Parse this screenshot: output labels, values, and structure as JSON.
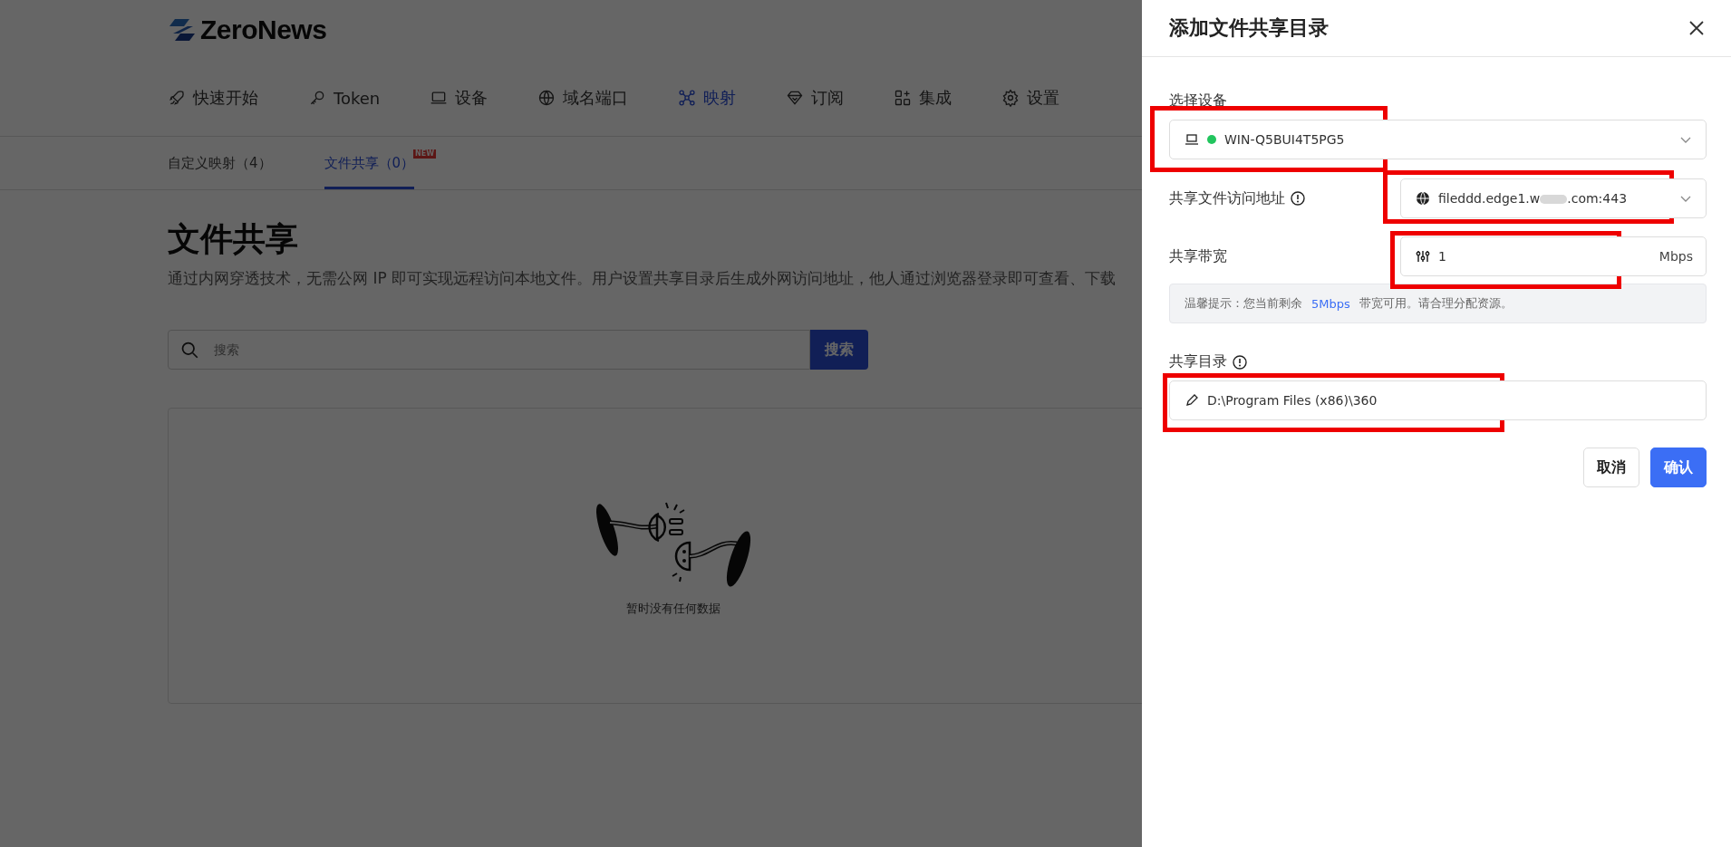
{
  "brand": {
    "name": "ZeroNews"
  },
  "nav": [
    {
      "label": "快速开始",
      "selected": false
    },
    {
      "label": "Token",
      "selected": false
    },
    {
      "label": "设备",
      "selected": false
    },
    {
      "label": "域名端口",
      "selected": false
    },
    {
      "label": "映射",
      "selected": true
    },
    {
      "label": "订阅",
      "selected": false
    },
    {
      "label": "集成",
      "selected": false
    },
    {
      "label": "设置",
      "selected": false
    }
  ],
  "subtabs": [
    {
      "label": "自定义映射（4）",
      "selected": false
    },
    {
      "label": "文件共享（0）",
      "selected": true,
      "badge": "NEW"
    }
  ],
  "page": {
    "title": "文件共享",
    "description": "通过内网穿透技术，无需公网 IP 即可实现远程访问本地文件。用户设置共享目录后生成外网访问地址，他人通过浏览器登录即可查看、下载",
    "search": {
      "placeholder": "搜索",
      "button": "搜索"
    },
    "empty_text": "暂时没有任何数据"
  },
  "drawer": {
    "title": "添加文件共享目录",
    "fields": [
      {
        "kind": "device",
        "label": "选择设备",
        "value": "WIN-Q5BUI4T5PG5",
        "online": true,
        "info": false,
        "highlighted": true
      },
      {
        "kind": "url",
        "label": "共享文件访问地址",
        "value_start": "fileddd.edge1.w",
        "value_end": ".com:443",
        "info": true,
        "highlighted": true
      },
      {
        "kind": "bandwidth",
        "label": "共享带宽",
        "value": "1",
        "unit": "Mbps",
        "info": false,
        "highlighted": true,
        "tip": {
          "before": "温馨提示：您当前剩余",
          "amount": "5Mbps",
          "after": "带宽可用。请合理分配资源。"
        }
      },
      {
        "kind": "path",
        "label": "共享目录",
        "value": "D:\\Program Files (x86)\\360",
        "info": true,
        "highlighted": true
      }
    ],
    "buttons": [
      {
        "label": "取消",
        "kind": "default"
      },
      {
        "label": "确认",
        "kind": "primary"
      }
    ]
  }
}
